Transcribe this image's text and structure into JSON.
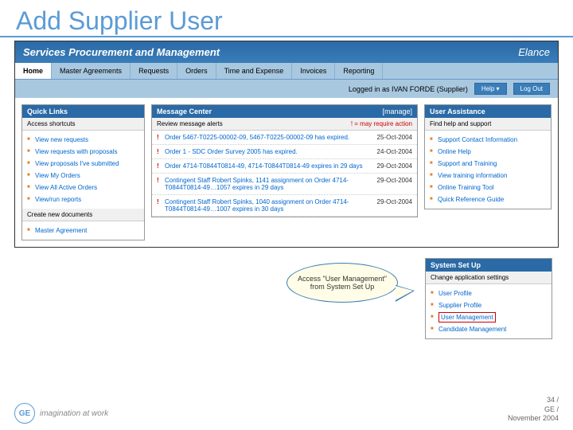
{
  "slide": {
    "title": "Add Supplier User"
  },
  "header": {
    "app_title": "Services Procurement and Management",
    "brand": "Elance"
  },
  "nav": {
    "tabs": [
      "Home",
      "Master Agreements",
      "Requests",
      "Orders",
      "Time and Expense",
      "Invoices",
      "Reporting"
    ],
    "active": 0
  },
  "topbar": {
    "logged_in": "Logged in as IVAN FORDE (Supplier)",
    "help": "Help ▾",
    "logout": "Log Out"
  },
  "quicklinks": {
    "title": "Quick Links",
    "sub": "Access shortcuts",
    "items": [
      "View new requests",
      "View requests with proposals",
      "View proposals I've submitted",
      "View My Orders",
      "View All Active Orders",
      "View/run reports"
    ],
    "sub2": "Create new documents",
    "items2": [
      "Master Agreement"
    ]
  },
  "msgcenter": {
    "title": "Message Center",
    "manage": "[manage]",
    "sub": "Review message alerts",
    "legend": "! = may require action",
    "msgs": [
      {
        "t": "Order 5467-T0225-00002-09, 5467-T0225-00002-09 has expired.",
        "d": "25-Oct-2004"
      },
      {
        "t": "Order 1 - SDC Order Survey 2005 has expired.",
        "d": "24-Oct-2004"
      },
      {
        "t": "Order 4714-T0844T0814-49, 4714-T0844T0814-49 expires in 29 days",
        "d": "29-Oct-2004"
      },
      {
        "t": "Contingent Staff Robert Spinks, 1141 assignment on Order 4714-T0844T0814-49…1057 expires in 29 days",
        "d": "29-Oct-2004"
      },
      {
        "t": "Contingent Staff Robert Spinks, 1040 assignment on Order 4714-T0844T0814-49…1007 expires in 30 days",
        "d": "29-Oct-2004"
      }
    ]
  },
  "assist": {
    "title": "User Assistance",
    "sub": "Find help and support",
    "items": [
      "Support Contact Information",
      "Online Help",
      "Support and Training",
      "View training information",
      "Online Training Tool",
      "Quick Reference Guide"
    ]
  },
  "system": {
    "title": "System Set Up",
    "sub": "Change application settings",
    "items": [
      "User Profile",
      "Supplier Profile",
      "User Management",
      "Candidate Management"
    ],
    "highlight_index": 2
  },
  "callout": {
    "text": "Access \"User Management\" from System Set Up"
  },
  "footer": {
    "tagline": "imagination at work",
    "page": "34 /",
    "org": "GE /",
    "date": "November 2004",
    "logo": "GE"
  }
}
